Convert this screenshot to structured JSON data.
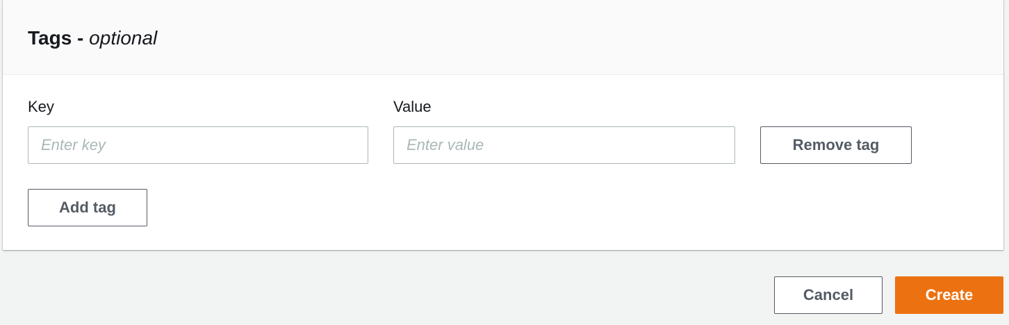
{
  "tags_section": {
    "title": "Tags",
    "title_separator": " - ",
    "title_optional": "optional",
    "key_label": "Key",
    "value_label": "Value",
    "key_placeholder": "Enter key",
    "value_placeholder": "Enter value",
    "key_value": "",
    "value_value": "",
    "remove_tag_label": "Remove tag",
    "add_tag_label": "Add tag"
  },
  "footer": {
    "cancel_label": "Cancel",
    "create_label": "Create"
  },
  "colors": {
    "primary": "#ec7211",
    "page_background": "#f2f3f3",
    "border": "#aab7b8",
    "button_text": "#545b64"
  }
}
